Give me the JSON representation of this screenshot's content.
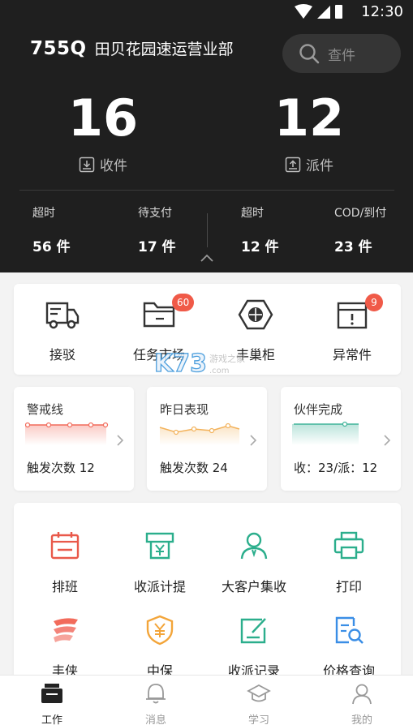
{
  "status_bar": {
    "time": "12:30"
  },
  "header": {
    "branch_code": "755Q",
    "branch_name": "田贝花园速运营业部"
  },
  "search": {
    "placeholder": "查件"
  },
  "stats": {
    "receive": {
      "count": "16",
      "label": "收件"
    },
    "deliver": {
      "count": "12",
      "label": "派件"
    }
  },
  "mini_stats": [
    {
      "label": "超时",
      "value": "56 件"
    },
    {
      "label": "待支付",
      "value": "17 件"
    },
    {
      "label": "超时",
      "value": "12 件"
    },
    {
      "label": "COD/到付",
      "value": "23 件"
    }
  ],
  "quick_actions": [
    {
      "label": "接驳",
      "icon": "truck-icon"
    },
    {
      "label": "任务市场",
      "icon": "folder-icon",
      "badge": "60"
    },
    {
      "label": "丰巢柜",
      "icon": "locker-icon"
    },
    {
      "label": "异常件",
      "icon": "exception-box-icon",
      "badge": "9"
    }
  ],
  "metric_cards": [
    {
      "title": "警戒线",
      "value": "触发次数 12",
      "color": "#f26b5b"
    },
    {
      "title": "昨日表现",
      "value": "触发次数 24",
      "color": "#f3b25a"
    },
    {
      "title": "伙伴完成",
      "value": "收：23/派：12",
      "color": "#3fb39a"
    }
  ],
  "tools": [
    {
      "label": "排班",
      "icon": "calendar-icon"
    },
    {
      "label": "收派计提",
      "icon": "yuan-receipt-icon"
    },
    {
      "label": "大客户集收",
      "icon": "person-icon"
    },
    {
      "label": "打印",
      "icon": "printer-icon"
    },
    {
      "label": "丰侠",
      "icon": "wing-icon"
    },
    {
      "label": "中保",
      "icon": "shield-yuan-icon"
    },
    {
      "label": "收派记录",
      "icon": "edit-record-icon"
    },
    {
      "label": "价格查询",
      "icon": "price-search-icon"
    }
  ],
  "watermark": {
    "logo": "K73",
    "text": "游戏之家",
    "url": ".com"
  },
  "tabbar": [
    {
      "label": "工作",
      "icon": "briefcase-icon"
    },
    {
      "label": "消息",
      "icon": "bell-icon"
    },
    {
      "label": "学习",
      "icon": "graduation-cap-icon"
    },
    {
      "label": "我的",
      "icon": "profile-icon"
    }
  ],
  "colors": {
    "header_bg": "#1f1f1f",
    "red": "#f05a48",
    "teal": "#3fb39a",
    "orange": "#f3b25a",
    "blue": "#3a8ee6"
  }
}
